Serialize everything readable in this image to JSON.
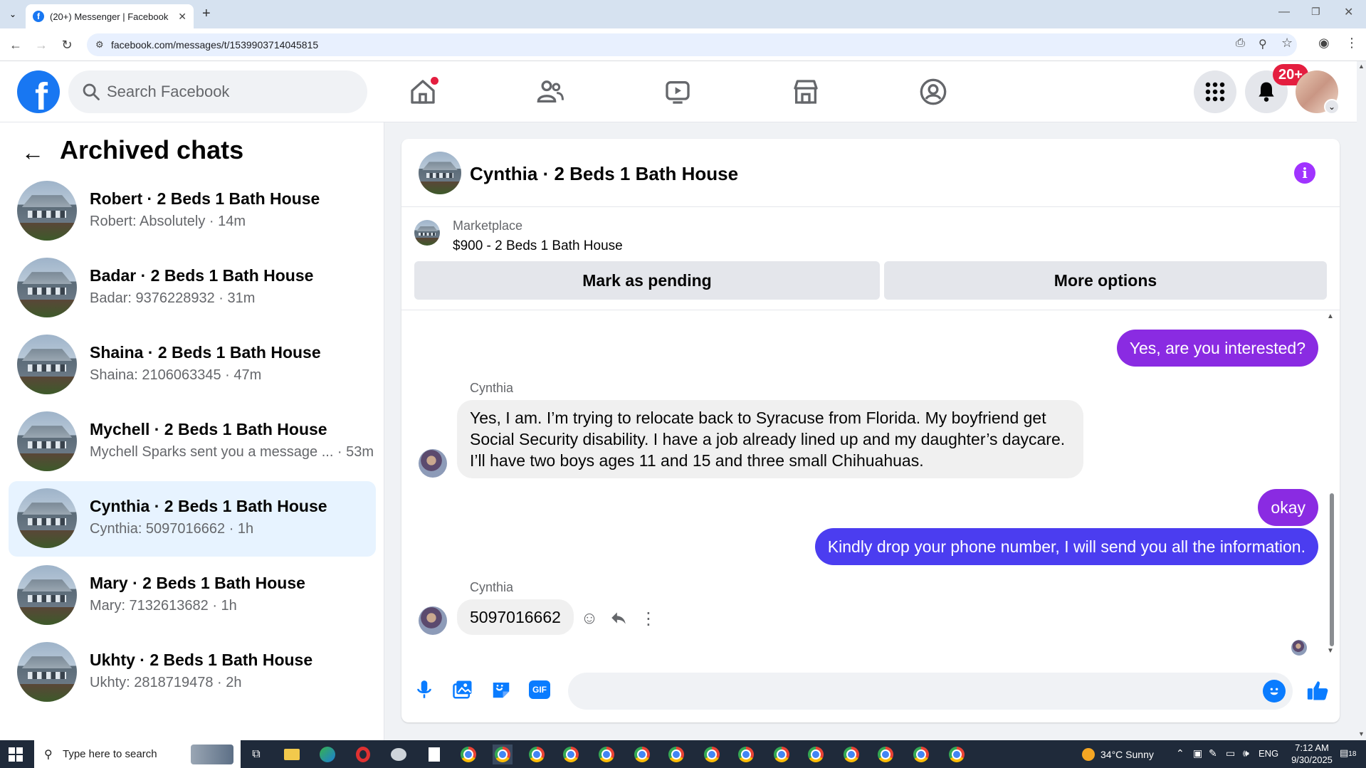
{
  "browser": {
    "tab_title": "(20+) Messenger | Facebook",
    "url": "facebook.com/messages/t/1539903714045815"
  },
  "fb": {
    "search_placeholder": "Search Facebook",
    "notif_badge": "20+"
  },
  "sidebar": {
    "title": "Archived chats",
    "chats": [
      {
        "name": "Robert · 2 Beds 1 Bath House",
        "preview": "Robert: Absolutely · 14m"
      },
      {
        "name": "Badar · 2 Beds 1 Bath House",
        "preview": "Badar: 9376228932 · 31m"
      },
      {
        "name": "Shaina · 2 Beds 1 Bath House",
        "preview": "Shaina: 2106063345 · 47m"
      },
      {
        "name": "Mychell · 2 Beds 1 Bath House",
        "preview": "Mychell Sparks sent you a message ... · 53m"
      },
      {
        "name": "Cynthia · 2 Beds 1 Bath House",
        "preview": "Cynthia: 5097016662 · 1h"
      },
      {
        "name": "Mary · 2 Beds 1 Bath House",
        "preview": "Mary: 7132613682 · 1h"
      },
      {
        "name": "Ukhty · 2 Beds 1 Bath House",
        "preview": "Ukhty: 2818719478 · 2h"
      }
    ]
  },
  "chat": {
    "title": "Cynthia · 2 Beds 1 Bath House",
    "marketplace_label": "Marketplace",
    "listing": "$900 - 2 Beds 1 Bath House",
    "mark_pending": "Mark as pending",
    "more_options": "More options",
    "messages": {
      "out1": "Yes, are you interested?",
      "sender1": "Cynthia",
      "in1": "Yes, I am. I’m trying to relocate back to Syracuse from Florida. My boyfriend get Social Security disability. I have a job already lined up and my daughter’s daycare. I’ll have two boys ages 11 and 15 and three small Chihuahuas.",
      "out2": "okay",
      "out3": "Kindly drop your phone number, I will send you all the information.",
      "sender2": "Cynthia",
      "in2": "5097016662"
    }
  },
  "taskbar": {
    "search_placeholder": "Type here to search",
    "weather": "34°C  Sunny",
    "lang": "ENG",
    "time": "7:12 AM",
    "date": "9/30/2025",
    "notif_count": "18"
  },
  "colors": {
    "fb_blue": "#1877f2",
    "outgoing_purple": "#8a2be2",
    "outgoing_blue": "#4b3df0",
    "active_chat_bg": "#e7f3ff"
  }
}
